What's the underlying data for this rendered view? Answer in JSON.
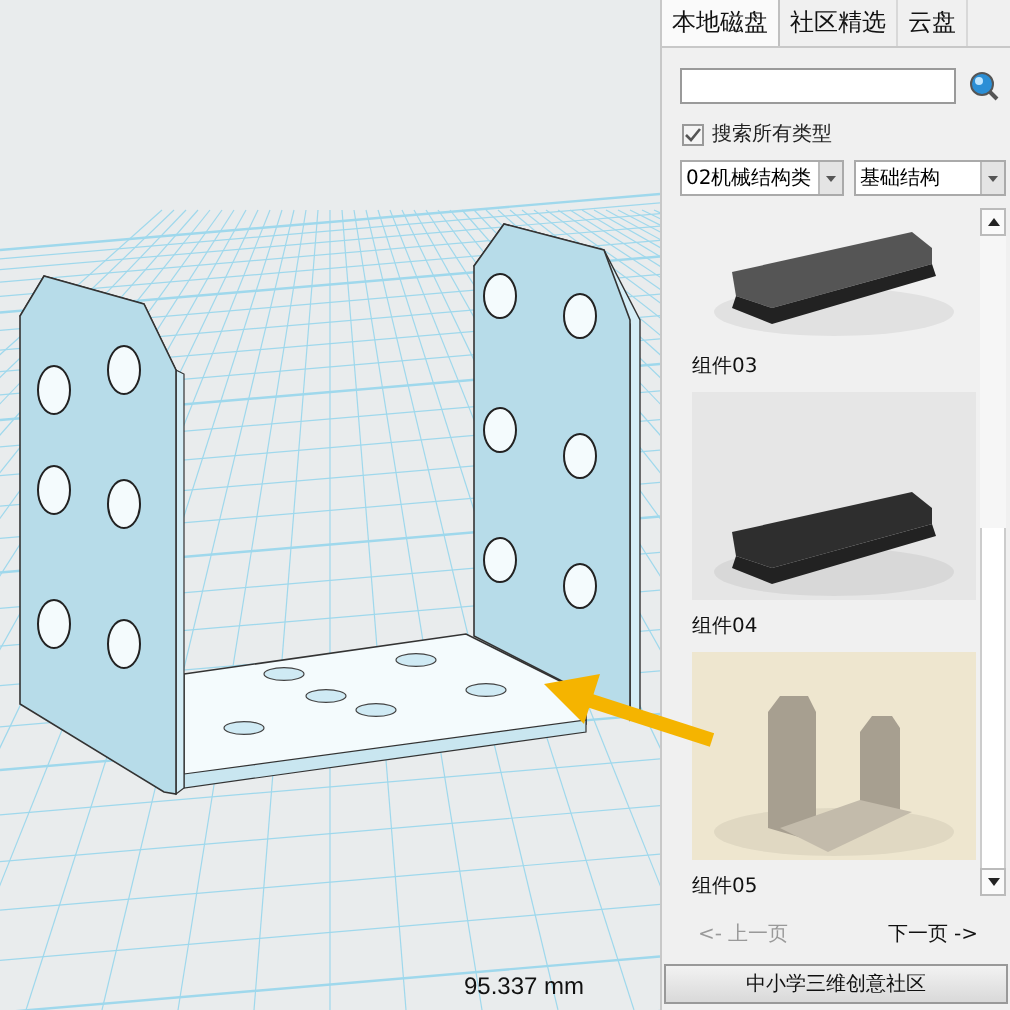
{
  "viewport": {
    "measurement": "95.337 mm"
  },
  "panel": {
    "tabs": [
      {
        "label": "本地磁盘",
        "selected": true
      },
      {
        "label": "社区精选",
        "selected": false
      },
      {
        "label": "云盘",
        "selected": false
      }
    ],
    "search_all_types": {
      "label": "搜索所有类型",
      "checked": true
    },
    "dropdowns": [
      {
        "value": "02机械结构类"
      },
      {
        "value": "基础结构"
      }
    ],
    "components": [
      {
        "label": "组件03",
        "kind": "picture"
      },
      {
        "label": "组件04",
        "kind": "picture"
      },
      {
        "label": "组件05",
        "kind": "picture"
      }
    ],
    "pagination": [
      {
        "label": "<- 上一页",
        "disabled": true
      },
      {
        "label": "下一页 ->",
        "disabled": false
      }
    ],
    "footer_button": "中小学三维创意社区"
  }
}
